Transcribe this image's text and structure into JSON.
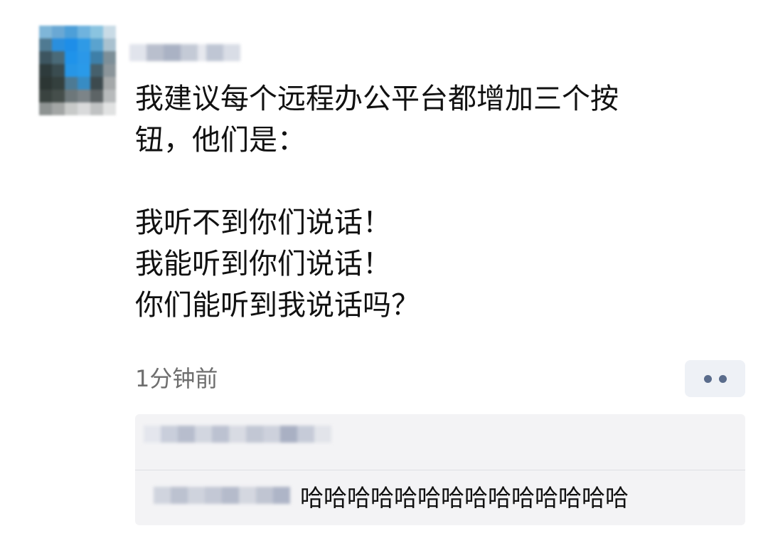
{
  "post": {
    "text": "我建议每个远程办公平台都增加三个按\n钮，他们是：\n\n我听不到你们说话！\n我能听到你们说话！\n你们能听到我说话吗？",
    "timestamp": "1分钟前"
  },
  "comment": {
    "text": "哈哈哈哈哈哈哈哈哈哈哈哈哈哈"
  },
  "icons": {
    "more": "more-dots-icon"
  },
  "colors": {
    "link_blue": "#5a6c8c",
    "panel_bg": "#f3f3f5",
    "text": "#111111",
    "muted": "#6e6e6e"
  }
}
